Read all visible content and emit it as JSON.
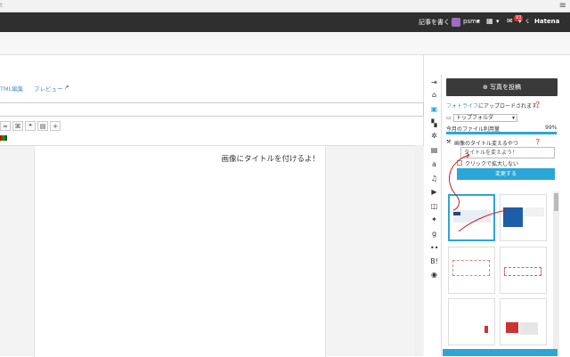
{
  "browser": {
    "url_fragment": "t",
    "menu_icon": "hamburger-icon"
  },
  "topbar": {
    "write_article": "記事を書く",
    "username": "psme",
    "notification_count": "93",
    "brand": "Hatena"
  },
  "editor": {
    "tabs": {
      "html_edit": "TML編集",
      "preview": "プレビュー"
    },
    "format_buttons": [
      "∞",
      "⌘",
      "❝",
      "▤",
      "+"
    ],
    "content_text": "画像にタイトルを付けるよ！"
  },
  "sidebar": {
    "post_photo_button": "写真を投稿",
    "upload_note_link": "フォトライフ",
    "upload_note_rest": "にアップロードされます。",
    "folder_value": "トップフォルダ",
    "usage_label": "今月のファイル利用量",
    "usage_percent": "99%",
    "usage_fraction": 0.99,
    "image_title_label": "画像のタイトル変えるやつ",
    "title_input_value": "タイトルを変えよう！",
    "enlarge_checkbox_label": "クリックで拡大しない",
    "change_button": "変更する"
  },
  "colors": {
    "accent": "#2aa6d8",
    "topbar_bg": "#2f2f2f",
    "post_button_bg": "#3a3a3a",
    "annotation_red": "#d02020"
  }
}
